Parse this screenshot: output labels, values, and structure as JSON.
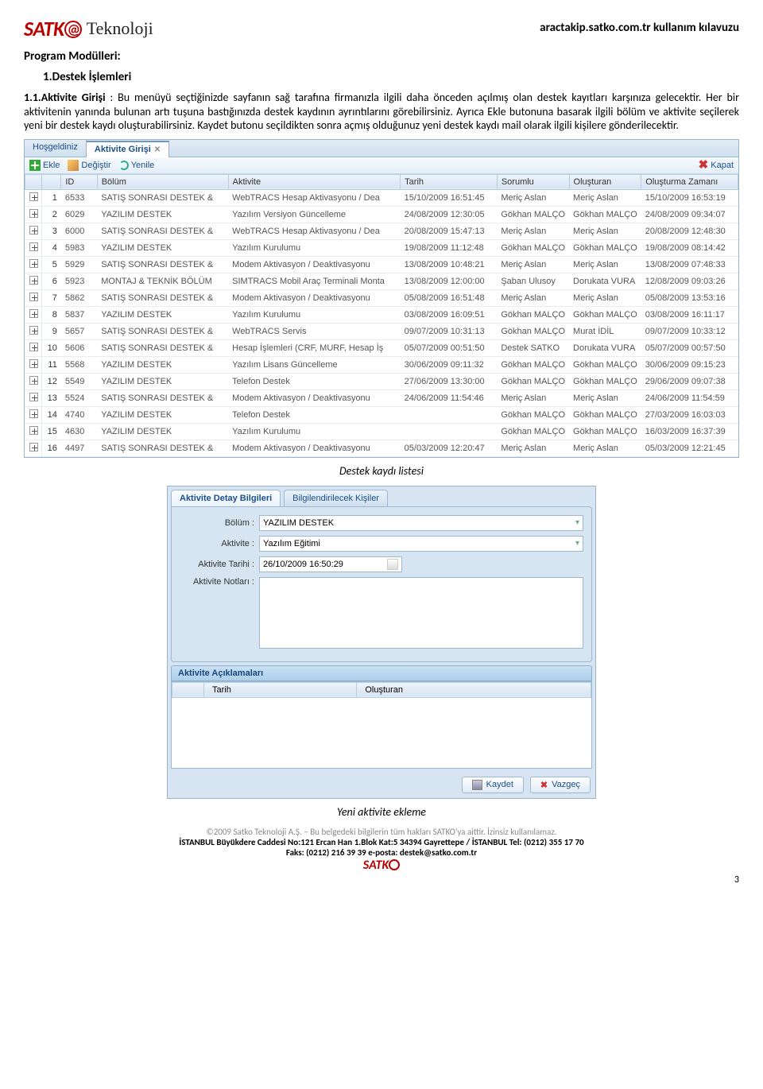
{
  "header": {
    "brand": "SATK",
    "tek": "Teknoloji",
    "right": "aractakip.satko.com.tr kullanım kılavuzu"
  },
  "doc": {
    "section_title": "Program Modülleri:",
    "sub1": "1.Destek İşlemleri",
    "sub2_lead": "1.1.Aktivite Girişi",
    "sub2_colon": " :  ",
    "para": "Bu menüyü seçtiğinizde sayfanın sağ tarafına firmanızla ilgili daha önceden açılmış olan destek kayıtları karşınıza gelecektir. Her bir aktivitenin yanında bulunan artı tuşuna bastığınızda destek kaydının ayrıntılarını görebilirsiniz. Ayrıca Ekle butonuna basarak ilgili bölüm ve aktivite seçilerek yeni bir destek kaydı oluşturabilirsiniz. Kaydet butonu seçildikten sonra açmış olduğunuz yeni destek kaydı mail olarak ilgili kişilere gönderilecektir.",
    "caption1": "Destek kaydı listesi",
    "caption2": "Yeni aktivite ekleme"
  },
  "app": {
    "tabs": [
      "Hoşgeldiniz",
      "Aktivite Girişi"
    ],
    "toolbar": {
      "ekle": "Ekle",
      "degistir": "Değiştir",
      "yenile": "Yenile",
      "kapat": "Kapat"
    },
    "columns": [
      "",
      "",
      "ID",
      "Bölüm",
      "Aktivite",
      "Tarih",
      "Sorumlu",
      "Oluşturan",
      "Oluşturma Zamanı"
    ],
    "rows": [
      {
        "n": "1",
        "id": "6533",
        "bolum": "SATIŞ SONRASI DESTEK &",
        "akt": "WebTRACS Hesap Aktivasyonu / Dea",
        "tarih": "15/10/2009 16:51:45",
        "sor": "Meriç Aslan",
        "olu": "Meriç Aslan",
        "oz": "15/10/2009 16:53:19"
      },
      {
        "n": "2",
        "id": "6029",
        "bolum": "YAZILIM DESTEK",
        "akt": "Yazılım Versiyon Güncelleme",
        "tarih": "24/08/2009 12:30:05",
        "sor": "Gökhan MALÇO",
        "olu": "Gökhan MALÇO",
        "oz": "24/08/2009 09:34:07"
      },
      {
        "n": "3",
        "id": "6000",
        "bolum": "SATIŞ SONRASI DESTEK &",
        "akt": "WebTRACS Hesap Aktivasyonu / Dea",
        "tarih": "20/08/2009 15:47:13",
        "sor": "Meriç Aslan",
        "olu": "Meriç Aslan",
        "oz": "20/08/2009 12:48:30"
      },
      {
        "n": "4",
        "id": "5983",
        "bolum": "YAZILIM DESTEK",
        "akt": "Yazılım Kurulumu",
        "tarih": "19/08/2009 11:12:48",
        "sor": "Gökhan MALÇO",
        "olu": "Gökhan MALÇO",
        "oz": "19/08/2009 08:14:42"
      },
      {
        "n": "5",
        "id": "5929",
        "bolum": "SATIŞ SONRASI DESTEK &",
        "akt": "Modem Aktivasyon / Deaktivasyonu",
        "tarih": "13/08/2009 10:48:21",
        "sor": "Meriç Aslan",
        "olu": "Meriç Aslan",
        "oz": "13/08/2009 07:48:33"
      },
      {
        "n": "6",
        "id": "5923",
        "bolum": "MONTAJ & TEKNİK BÖLÜM",
        "akt": "SIMTRACS Mobil Araç Terminali Monta",
        "tarih": "13/08/2009 12:00:00",
        "sor": "Şaban Ulusoy",
        "olu": "Dorukata VURA",
        "oz": "12/08/2009 09:03:26"
      },
      {
        "n": "7",
        "id": "5862",
        "bolum": "SATIŞ SONRASI DESTEK &",
        "akt": "Modem Aktivasyon / Deaktivasyonu",
        "tarih": "05/08/2009 16:51:48",
        "sor": "Meriç Aslan",
        "olu": "Meriç Aslan",
        "oz": "05/08/2009 13:53:16"
      },
      {
        "n": "8",
        "id": "5837",
        "bolum": "YAZILIM DESTEK",
        "akt": "Yazılım Kurulumu",
        "tarih": "03/08/2009 16:09:51",
        "sor": "Gökhan MALÇO",
        "olu": "Gökhan MALÇO",
        "oz": "03/08/2009 16:11:17"
      },
      {
        "n": "9",
        "id": "5657",
        "bolum": "SATIŞ SONRASI DESTEK &",
        "akt": "WebTRACS Servis",
        "tarih": "09/07/2009 10:31:13",
        "sor": "Gökhan MALÇO",
        "olu": "Murat İDİL",
        "oz": "09/07/2009 10:33:12"
      },
      {
        "n": "10",
        "id": "5606",
        "bolum": "SATIŞ SONRASI DESTEK &",
        "akt": "Hesap İşlemleri (CRF, MURF, Hesap İş",
        "tarih": "05/07/2009 00:51:50",
        "sor": "Destek SATKO",
        "olu": "Dorukata VURA",
        "oz": "05/07/2009 00:57:50"
      },
      {
        "n": "11",
        "id": "5568",
        "bolum": "YAZILIM DESTEK",
        "akt": "Yazılım Lisans Güncelleme",
        "tarih": "30/06/2009 09:11:32",
        "sor": "Gökhan MALÇO",
        "olu": "Gökhan MALÇO",
        "oz": "30/06/2009 09:15:23"
      },
      {
        "n": "12",
        "id": "5549",
        "bolum": "YAZILIM DESTEK",
        "akt": "Telefon Destek",
        "tarih": "27/06/2009 13:30:00",
        "sor": "Gökhan MALÇO",
        "olu": "Gökhan MALÇO",
        "oz": "29/06/2009 09:07:38"
      },
      {
        "n": "13",
        "id": "5524",
        "bolum": "SATIŞ SONRASI DESTEK &",
        "akt": "Modem Aktivasyon / Deaktivasyonu",
        "tarih": "24/06/2009 11:54:46",
        "sor": "Meriç Aslan",
        "olu": "Meriç Aslan",
        "oz": "24/06/2009 11:54:59"
      },
      {
        "n": "14",
        "id": "4740",
        "bolum": "YAZILIM DESTEK",
        "akt": "Telefon Destek",
        "tarih": "",
        "sor": "Gökhan MALÇO",
        "olu": "Gökhan MALÇO",
        "oz": "27/03/2009 16:03:03"
      },
      {
        "n": "15",
        "id": "4630",
        "bolum": "YAZILIM DESTEK",
        "akt": "Yazılım Kurulumu",
        "tarih": "",
        "sor": "Gökhan MALÇO",
        "olu": "Gökhan MALÇO",
        "oz": "16/03/2009 16:37:39"
      },
      {
        "n": "16",
        "id": "4497",
        "bolum": "SATIŞ SONRASI DESTEK &",
        "akt": "Modem Aktivasyon / Deaktivasyonu",
        "tarih": "05/03/2009 12:20:47",
        "sor": "Meriç Aslan",
        "olu": "Meriç Aslan",
        "oz": "05/03/2009 12:21:45"
      }
    ]
  },
  "detail": {
    "tab1": "Aktivite Detay Bilgileri",
    "tab2": "Bilgilendirilecek Kişiler",
    "l_bolum": "Bölüm :",
    "v_bolum": "YAZILIM DESTEK",
    "l_akt": "Aktivite :",
    "v_akt": "Yazılım Eğitimi",
    "l_tarih": "Aktivite Tarihi :",
    "v_tarih": "26/10/2009 16:50:29",
    "l_not": "Aktivite Notları :",
    "section": "Aktivite Açıklamaları",
    "col1": "Tarih",
    "col2": "Oluşturan",
    "save": "Kaydet",
    "cancel": "Vazgeç"
  },
  "footer": {
    "copy": "©2009 Satko Teknoloji A.Ş. – Bu belgedeki bilgilerin tüm hakları SATKO'ya aittir. İzinsiz kullanılamaz.",
    "addr1": "İSTANBUL Büyükdere Caddesi No:121 Ercan Han 1.Blok Kat:5 34394 Gayrettepe / İSTANBUL Tel: (0212) 355 17 70",
    "addr2": "Faks: (0212) 216 39 39 e-posta: destek@satko.com.tr",
    "logo": "SATK",
    "page": "3"
  }
}
